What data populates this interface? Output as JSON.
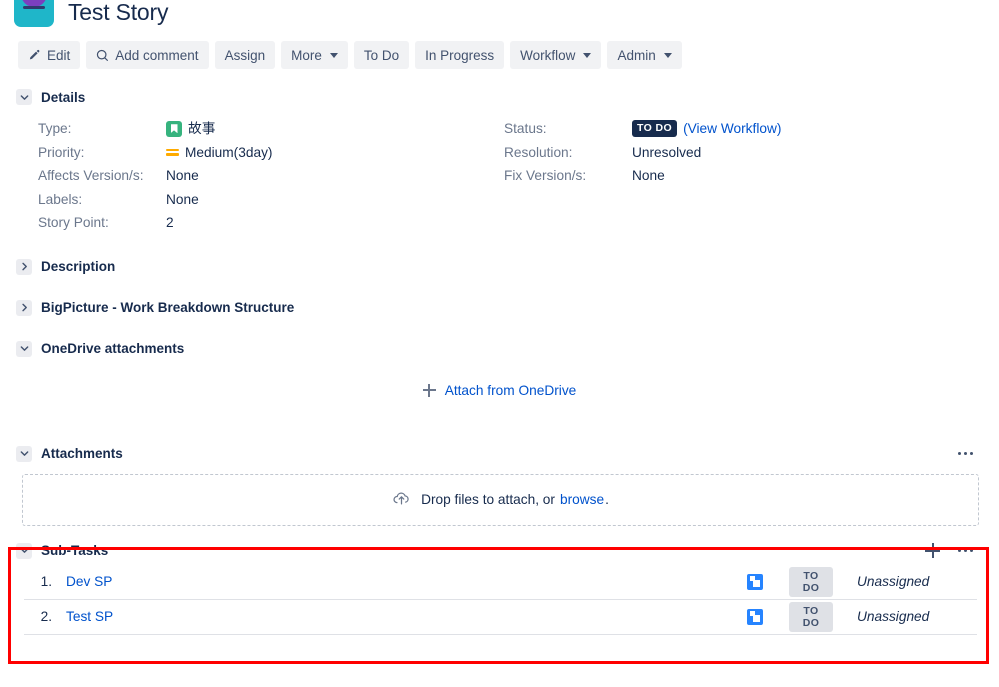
{
  "header": {
    "title": "Test Story",
    "avatar_icon": "user-avatar-icon"
  },
  "toolbar": {
    "edit_label": "Edit",
    "add_comment_label": "Add comment",
    "assign_label": "Assign",
    "more_label": "More",
    "todo_label": "To Do",
    "in_progress_label": "In Progress",
    "workflow_label": "Workflow",
    "admin_label": "Admin"
  },
  "details": {
    "section_title": "Details",
    "left": [
      {
        "label": "Type:",
        "value": "故事"
      },
      {
        "label": "Priority:",
        "value": "Medium(3day)"
      },
      {
        "label": "Affects Version/s:",
        "value": "None"
      },
      {
        "label": "Labels:",
        "value": "None"
      },
      {
        "label": "Story Point:",
        "value": "2"
      }
    ],
    "right": [
      {
        "label": "Status:",
        "value": "TO DO"
      },
      {
        "label": "Resolution:",
        "value": "Unresolved"
      },
      {
        "label": "Fix Version/s:",
        "value": "None"
      }
    ],
    "view_workflow_label": "(View Workflow)",
    "status_badge_color": "#172b4d",
    "link_color": "#0052cc"
  },
  "description": {
    "section_title": "Description"
  },
  "bigpicture": {
    "section_title": "BigPicture - Work Breakdown Structure"
  },
  "onedrive": {
    "section_title": "OneDrive attachments",
    "attach_label": "Attach from OneDrive"
  },
  "attachments": {
    "section_title": "Attachments",
    "drop_text": "Drop files to attach, or",
    "browse_label": "browse",
    "drop_text_end": "."
  },
  "subtasks": {
    "section_title": "Sub-Tasks",
    "rows": [
      {
        "num": "1.",
        "name": "Dev SP",
        "status": "TO DO",
        "assignee": "Unassigned"
      },
      {
        "num": "2.",
        "name": "Test SP",
        "status": "TO DO",
        "assignee": "Unassigned"
      }
    ],
    "highlight_color": "#ff0000"
  }
}
